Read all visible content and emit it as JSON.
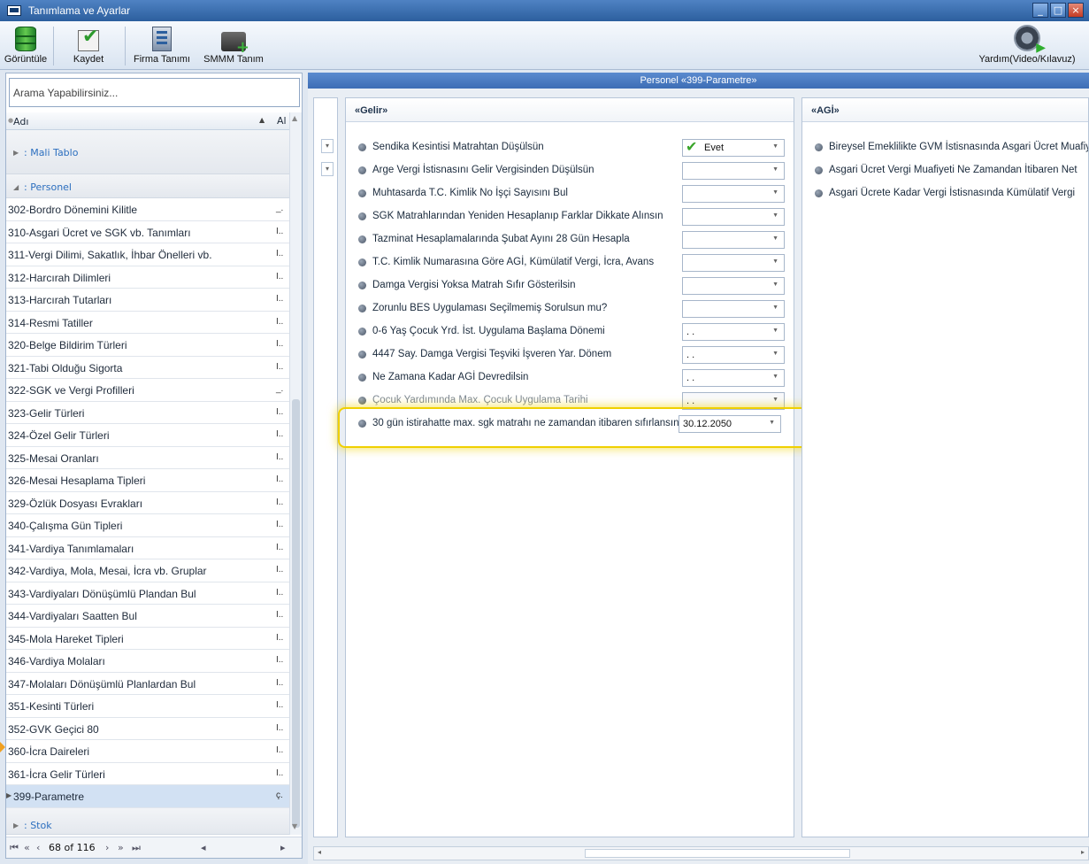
{
  "window": {
    "title": "Tanımlama ve Ayarlar"
  },
  "toolbar": {
    "buttons": [
      {
        "label": "Görüntüle",
        "icon": "database-icon"
      },
      {
        "label": "Kaydet",
        "icon": "checkmark-icon"
      },
      {
        "label": "Firma Tanımı",
        "icon": "building-icon"
      },
      {
        "label": "SMMM Tanım",
        "icon": "briefcase-add-icon"
      }
    ],
    "help": {
      "label": "Yardım(Video/Kılavuz)",
      "icon": "film-reel-icon"
    }
  },
  "left": {
    "search_placeholder": "Arama Yapabilirsiniz...",
    "columns": {
      "name": "Adı",
      "value": "Al"
    },
    "groups": {
      "mali_tablo": ": Mali Tablo",
      "personel": ": Personel",
      "stok": ": Stok"
    },
    "rows": [
      {
        "name": "302-Bordro Dönemini Kilitle",
        "value": "_."
      },
      {
        "name": "310-Asgari Ücret ve SGK vb. Tanımları",
        "value": "I.."
      },
      {
        "name": "311-Vergi Dilimi, Sakatlık, İhbar Önelleri vb.",
        "value": "I.."
      },
      {
        "name": "312-Harcırah Dilimleri",
        "value": "I.."
      },
      {
        "name": "313-Harcırah Tutarları",
        "value": "I.."
      },
      {
        "name": "314-Resmi Tatiller",
        "value": "I.."
      },
      {
        "name": "320-Belge Bildirim Türleri",
        "value": "I.."
      },
      {
        "name": "321-Tabi Olduğu Sigorta",
        "value": "I.."
      },
      {
        "name": "322-SGK ve Vergi Profilleri",
        "value": "_."
      },
      {
        "name": "323-Gelir Türleri",
        "value": "I.."
      },
      {
        "name": "324-Özel Gelir Türleri",
        "value": "I.."
      },
      {
        "name": "325-Mesai Oranları",
        "value": "I.."
      },
      {
        "name": "326-Mesai Hesaplama Tipleri",
        "value": "I.."
      },
      {
        "name": "329-Özlük Dosyası Evrakları",
        "value": "I.."
      },
      {
        "name": "340-Çalışma Gün Tipleri",
        "value": "I.."
      },
      {
        "name": "341-Vardiya Tanımlamaları",
        "value": "I.."
      },
      {
        "name": "342-Vardiya, Mola, Mesai, İcra vb. Gruplar",
        "value": "I.."
      },
      {
        "name": "343-Vardiyaları Dönüşümlü Plandan Bul",
        "value": "I.."
      },
      {
        "name": "344-Vardiyaları Saatten Bul",
        "value": "I.."
      },
      {
        "name": "345-Mola Hareket Tipleri",
        "value": "I.."
      },
      {
        "name": "346-Vardiya Molaları",
        "value": "I.."
      },
      {
        "name": "347-Molaları Dönüşümlü Planlardan Bul",
        "value": "I.."
      },
      {
        "name": "351-Kesinti Türleri",
        "value": "I.."
      },
      {
        "name": "352-GVK Geçici 80",
        "value": "I.."
      },
      {
        "name": "360-İcra Daireleri",
        "value": "I.."
      },
      {
        "name": "361-İcra Gelir Türleri",
        "value": "I.."
      },
      {
        "name": "399-Parametre",
        "value": "ç."
      }
    ],
    "pager": {
      "text": "68 of 116"
    }
  },
  "main": {
    "header": "Personel «399-Parametre»",
    "gelir": {
      "title": "«Gelir»",
      "items": [
        {
          "label": "Sendika Kesintisi Matrahtan Düşülsün",
          "value": "Evet"
        },
        {
          "label": "Arge Vergi İstisnasını Gelir Vergisinden Düşülsün",
          "value": ""
        },
        {
          "label": "Muhtasarda T.C. Kimlik No İşçi Sayısını Bul",
          "value": ""
        },
        {
          "label": "SGK Matrahlarından Yeniden Hesaplanıp Farklar Dikkate Alınsın",
          "value": ""
        },
        {
          "label": "Tazminat Hesaplamalarında Şubat Ayını 28 Gün Hesapla",
          "value": ""
        },
        {
          "label": "T.C. Kimlik Numarasına Göre AGİ, Kümülatif Vergi, İcra, Avans",
          "value": ""
        },
        {
          "label": "Damga Vergisi Yoksa Matrah Sıfır Gösterilsin",
          "value": ""
        },
        {
          "label": "Zorunlu BES Uygulaması Seçilmemiş Sorulsun mu?",
          "value": ""
        },
        {
          "label": "0-6 Yaş Çocuk Yrd. İst. Uygulama Başlama Dönemi",
          "value": ". ."
        },
        {
          "label": "4447 Say. Damga Vergisi Teşviki İşveren Yar. Dönem",
          "value": ". ."
        },
        {
          "label": "Ne Zamana Kadar AGİ Devredilsin",
          "value": ". ."
        },
        {
          "label": "Çocuk Yardımında Max. Çocuk Uygulama Tarihi",
          "value": ". ."
        },
        {
          "label": "30 gün istirahatte max. sgk matrahı ne zamandan itibaren sıfırlansın",
          "value": "30.12.2050"
        }
      ]
    },
    "agi": {
      "title": "«AGİ»",
      "items": [
        {
          "label": "Bireysel Emeklilikte GVM İstisnasında Asgari Ücret Muafiyeti"
        },
        {
          "label": "Asgari Ücret Vergi Muafiyeti Ne Zamandan İtibaren Net"
        },
        {
          "label": "Asgari Ücrete Kadar Vergi İstisnasında Kümülatif Vergi"
        }
      ]
    }
  }
}
